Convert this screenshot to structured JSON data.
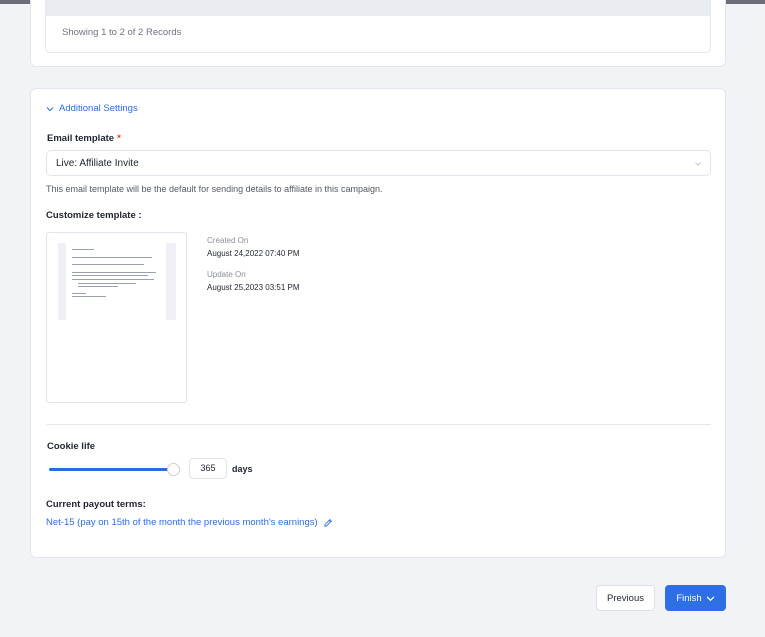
{
  "records": {
    "summary": "Showing 1 to 2 of 2 Records"
  },
  "additional_settings": {
    "toggle_label": "Additional Settings",
    "email_template": {
      "label": "Email template",
      "required_mark": "*",
      "selected": "Live:  Affiliate Invite",
      "hint": "This email template will be the default for sending details to affiliate in this campaign."
    },
    "customize": {
      "label": "Customize template :",
      "created_label": "Created On",
      "created_value": "August 24,2022 07:40 PM",
      "updated_label": "Update On",
      "updated_value": "August 25,2023 03:51 PM"
    },
    "cookie": {
      "label": "Cookie life",
      "value": "365",
      "unit": "days",
      "slider_fraction": 1.0
    },
    "payout": {
      "label": "Current payout terms:",
      "terms": "Net-15 (pay on 15th of the month the previous month's earnings)"
    }
  },
  "footer": {
    "previous_label": "Previous",
    "finish_label": "Finish"
  },
  "colors": {
    "accent": "#2f6fe6",
    "link": "#2b6de0",
    "required": "#e0413a",
    "background": "#f2f3f7"
  },
  "icons": {
    "toggle": "chevron-down-icon",
    "select": "chevron-down-icon",
    "edit": "pencil-icon",
    "finish": "chevron-down-icon"
  }
}
